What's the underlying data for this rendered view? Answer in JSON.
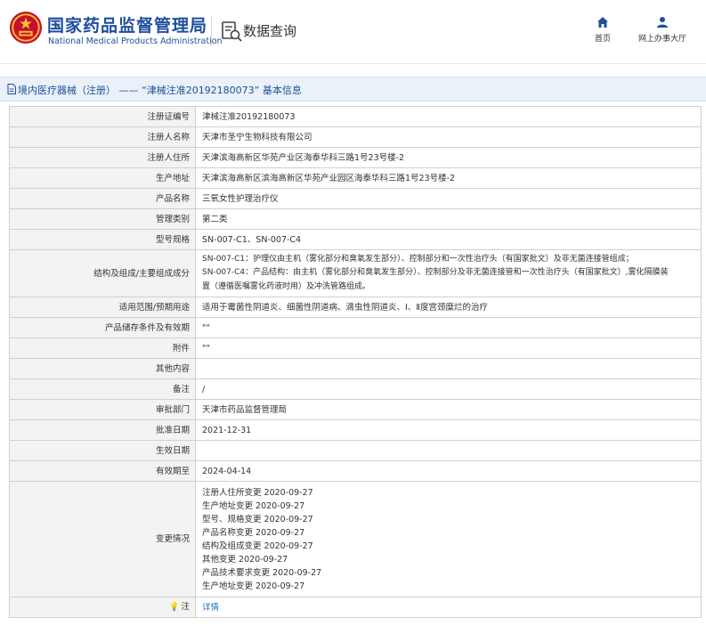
{
  "header": {
    "site_name_cn": "国家药品监督管理局",
    "site_name_en": "National Medical Products Administration",
    "query_title": "数据查询",
    "nav": [
      {
        "label": "首页",
        "icon": "home-icon"
      },
      {
        "label": "网上办事大厅",
        "icon": "user-icon"
      }
    ]
  },
  "breadcrumb": {
    "text": "境内医疗器械（注册） —— “津械注准20192180073” 基本信息"
  },
  "colors": {
    "brand_blue": "#1f4e9c",
    "breadcrumb_bg": "#eaf1f8",
    "label_bg": "#f3f3f3",
    "link": "#1f6fc8"
  },
  "rows": [
    {
      "label": "注册证编号",
      "value": "津械注准20192180073"
    },
    {
      "label": "注册人名称",
      "value": "天津市圣宁生物科技有限公司"
    },
    {
      "label": "注册人住所",
      "value": "天津滨海高新区华苑产业区海泰华科三路1号23号楼-2"
    },
    {
      "label": "生产地址",
      "value": "天津滨海高新区滨海高新区华苑产业园区海泰华科三路1号23号楼-2"
    },
    {
      "label": "产品名称",
      "value": "三氧女性护理治疗仪"
    },
    {
      "label": "管理类别",
      "value": "第二类"
    },
    {
      "label": "型号规格",
      "value": "SN-007-C1、SN-007-C4"
    },
    {
      "label": "结构及组成/主要组成成分",
      "lines": [
        "SN-007-C1：护理仪由主机（雾化部分和臭氧发生部分）、控制部分和一次性治疗头（有国家批文）及非无菌连接管组成；",
        "SN-007-C4：产品结构：由主机（雾化部分和臭氧发生部分）、控制部分及非无菌连接管和一次性治疗头（有国家批文）,雾化隔膜装",
        "置（遵循医嘱雾化药液时用）及冲洗管路组成。"
      ]
    },
    {
      "label": "适用范围/预期用途",
      "value": "适用于霉菌性阴道炎、细菌性阴道病、滴虫性阴道炎、Ⅰ、Ⅱ度宫颈糜烂的治疗"
    },
    {
      "label": "产品储存条件及有效期",
      "value": "\"\""
    },
    {
      "label": "附件",
      "value": "\"\""
    },
    {
      "label": "其他内容",
      "value": ""
    },
    {
      "label": "备注",
      "value": "/"
    },
    {
      "label": "审批部门",
      "value": "天津市药品监督管理局"
    },
    {
      "label": "批准日期",
      "value": "2021-12-31"
    },
    {
      "label": "生效日期",
      "value": ""
    },
    {
      "label": "有效期至",
      "value": "2024-04-14"
    },
    {
      "label": "变更情况",
      "lines": [
        "注册人住所变更 2020-09-27",
        "生产地址变更 2020-09-27",
        "型号、规格变更 2020-09-27",
        "产品名称变更 2020-09-27",
        "结构及组成变更 2020-09-27",
        "其他变更 2020-09-27",
        "产品技术要求变更 2020-09-27",
        "生产地址变更 2020-09-27"
      ]
    },
    {
      "label": "注",
      "note_icon": "bulb-icon",
      "link": "详情"
    }
  ]
}
